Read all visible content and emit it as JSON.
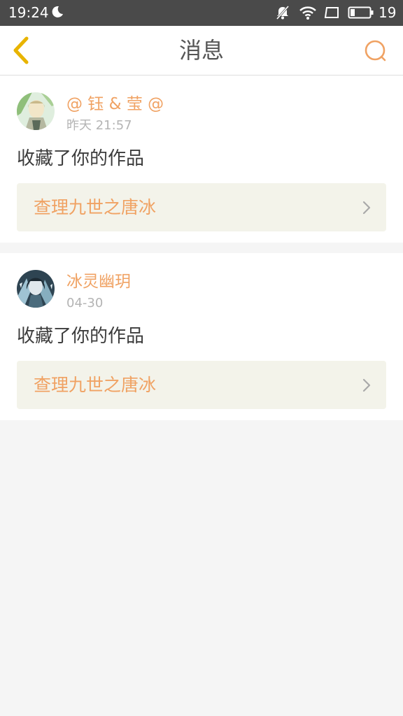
{
  "status_bar": {
    "time": "19:24",
    "battery": "19"
  },
  "header": {
    "title": "消息"
  },
  "colors": {
    "accent": "#f0a263",
    "back_icon": "#e8b400",
    "status_bar_bg": "#4a4a4a",
    "page_bg": "#f5f5f5",
    "work_link_bg": "#f3f3ea"
  },
  "messages": [
    {
      "user": "@ 钰 & 莹 @",
      "time": "昨天 21:57",
      "action": "收藏了你的作品",
      "work_title": "查理九世之唐冰"
    },
    {
      "user": "冰灵幽玥",
      "time": "04-30",
      "action": "收藏了你的作品",
      "work_title": "查理九世之唐冰"
    }
  ],
  "icons": {
    "back": "chevron-left-icon",
    "search": "search-icon",
    "link_arrow": "chevron-right-icon",
    "status": [
      "moon-icon",
      "bell-off-icon",
      "wifi-icon",
      "screen-icon",
      "battery-icon"
    ]
  }
}
